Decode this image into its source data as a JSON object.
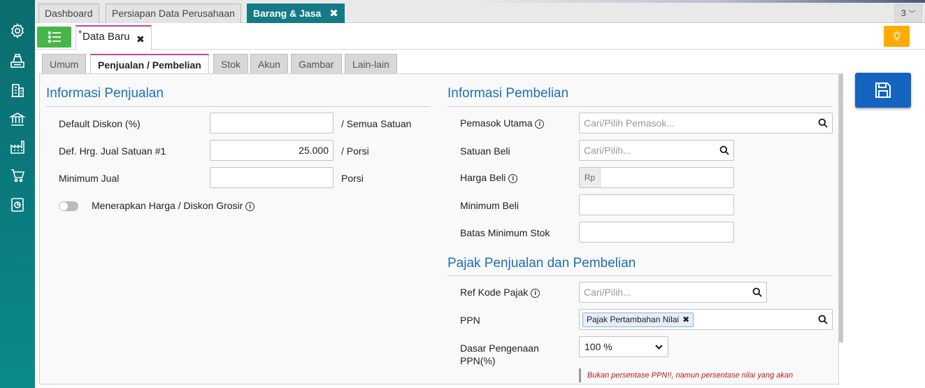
{
  "top_tabs": [
    {
      "label": "Dashboard"
    },
    {
      "label": "Persiapan Data Perusahaan"
    },
    {
      "label": "Barang & Jasa"
    }
  ],
  "tab_overflow": "3",
  "doc_tab": {
    "marker": "*",
    "title": "Data Baru"
  },
  "sub_tabs": [
    "Umum",
    "Penjualan / Pembelian",
    "Stok",
    "Akun",
    "Gambar",
    "Lain-lain"
  ],
  "sales": {
    "title": "Informasi Penjualan",
    "default_discount": {
      "label": "Default Diskon (%)",
      "value": "",
      "unit": "/ Semua Satuan"
    },
    "default_price": {
      "label": "Def. Hrg. Jual Satuan #1",
      "value": "25.000",
      "unit": "/ Porsi"
    },
    "min_sale": {
      "label": "Minimum Jual",
      "value": "",
      "unit": "Porsi"
    },
    "wholesale_toggle": {
      "label": "Menerapkan Harga / Diskon Grosir",
      "on": false
    }
  },
  "purchase": {
    "title": "Informasi Pembelian",
    "main_supplier": {
      "label": "Pemasok Utama",
      "placeholder": "Cari/Pilih Pemasok..."
    },
    "purchase_unit": {
      "label": "Satuan Beli",
      "placeholder": "Cari/Pilih..."
    },
    "purchase_price": {
      "label": "Harga Beli",
      "prefix": "Rp",
      "value": ""
    },
    "min_purchase": {
      "label": "Minimum Beli",
      "value": ""
    },
    "min_stock": {
      "label": "Batas Minimum Stok",
      "value": ""
    }
  },
  "tax": {
    "title": "Pajak Penjualan dan Pembelian",
    "tax_code": {
      "label": "Ref Kode Pajak",
      "placeholder": "Cari/Pilih..."
    },
    "ppn": {
      "label": "PPN",
      "chip": "Pajak Pertambahan Nilai"
    },
    "ppn_base": {
      "label_line1": "Dasar Pengenaan",
      "label_line2": "PPN(%)",
      "selected": "100 %"
    },
    "note": "Bukan persentase PPN!!, namun persentase nilai yang akan"
  },
  "colors": {
    "accent_teal": "#137a86",
    "save_blue": "#1565c0",
    "green": "#47b649",
    "amber": "#ffab00",
    "heading_blue": "#1f6fb6"
  },
  "icons": {
    "sidebar": [
      "gear-icon",
      "cash-register-icon",
      "building-icon",
      "bank-icon",
      "factory-icon",
      "cart-icon",
      "report-icon"
    ],
    "toolbar": [
      "list-icon",
      "bulb-icon",
      "save-icon",
      "search-icon",
      "close-icon",
      "info-icon",
      "chevron-down-icon"
    ]
  }
}
